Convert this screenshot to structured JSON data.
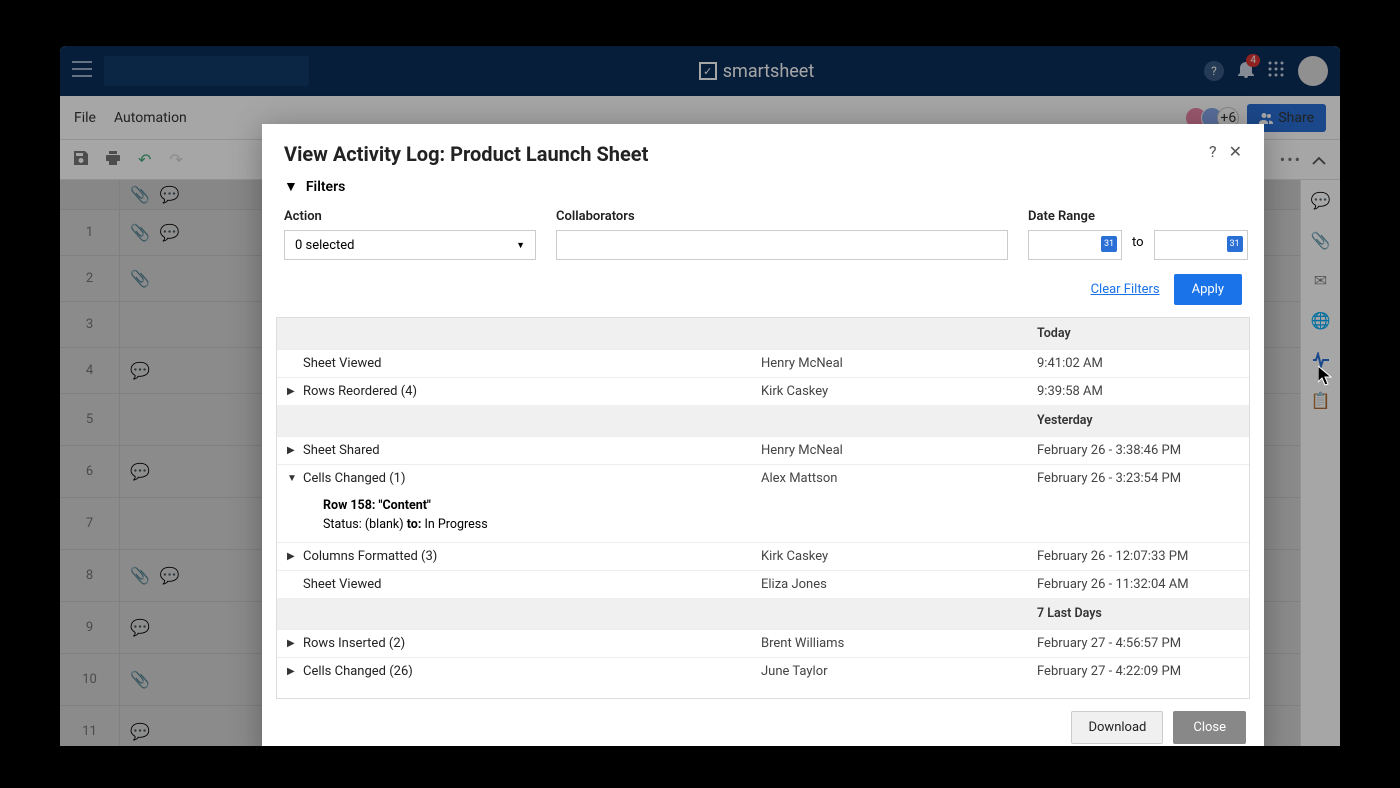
{
  "topbar": {
    "logo": "smartsheet",
    "notif_count": "4"
  },
  "menubar": {
    "file": "File",
    "automation": "Automation",
    "collab_plus": "+6",
    "share": "Share"
  },
  "modal": {
    "title": "View Activity Log: Product Launch Sheet",
    "filters_label": "Filters",
    "action_label": "Action",
    "action_value": "0 selected",
    "collaborators_label": "Collaborators",
    "date_range_label": "Date Range",
    "to_label": "to",
    "clear_filters": "Clear Filters",
    "apply": "Apply",
    "download": "Download",
    "close": "Close"
  },
  "log": {
    "groups": [
      {
        "header": "Today",
        "rows": [
          {
            "caret": "",
            "action": "Sheet Viewed",
            "user": "Henry McNeal",
            "time": "9:41:02 AM"
          },
          {
            "caret": "▶",
            "action": "Rows Reordered (4)",
            "user": "Kirk Caskey",
            "time": "9:39:58 AM"
          }
        ]
      },
      {
        "header": "Yesterday",
        "rows": [
          {
            "caret": "▶",
            "action": "Sheet Shared",
            "user": "Henry McNeal",
            "time": "February 26 - 3:38:46 PM"
          },
          {
            "caret": "▼",
            "action": "Cells Changed (1)",
            "user": "Alex Mattson",
            "time": "February 26 - 3:23:54 PM",
            "detail_title": "Row 158: \"Content\"",
            "detail_body_prefix": "Status: (blank) ",
            "detail_to": "to:",
            "detail_value": "  In Progress"
          },
          {
            "caret": "▶",
            "action": "Columns Formatted (3)",
            "user": "Kirk Caskey",
            "time": "February 26 - 12:07:33 PM"
          },
          {
            "caret": "",
            "action": "Sheet Viewed",
            "user": "Eliza Jones",
            "time": "February 26 - 11:32:04 AM"
          }
        ]
      },
      {
        "header": "7 Last Days",
        "rows": [
          {
            "caret": "▶",
            "action": "Rows Inserted (2)",
            "user": "Brent Williams",
            "time": "February 27 - 4:56:57 PM"
          },
          {
            "caret": "▶",
            "action": "Cells Changed (26)",
            "user": "June Taylor",
            "time": "February 27 - 4:22:09 PM"
          }
        ]
      }
    ]
  },
  "rows": [
    "1",
    "2",
    "3",
    "4",
    "5",
    "6",
    "7",
    "8",
    "9",
    "10",
    "11"
  ]
}
